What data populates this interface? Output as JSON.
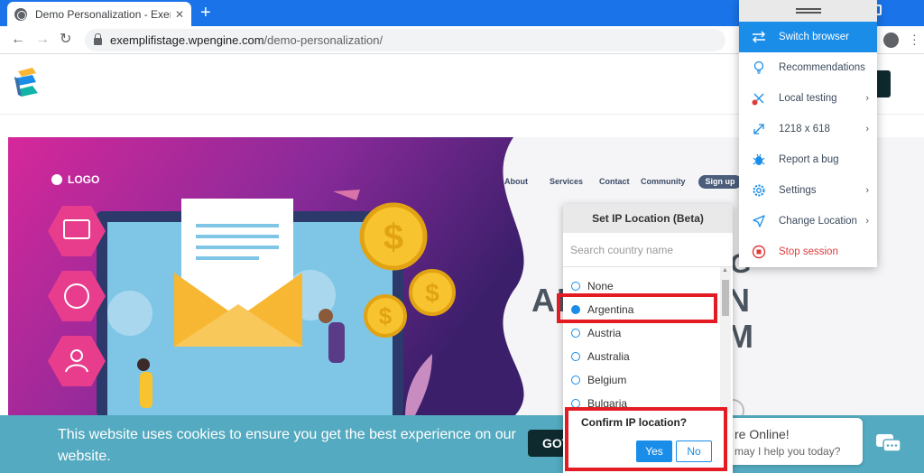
{
  "browser": {
    "tab_title": "Demo Personalization - Exemplifi",
    "tab_close": "✕",
    "new_tab": "+",
    "url_domain": "exemplifistage.wpengine.com",
    "url_path": "/demo-personalization/"
  },
  "hero": {
    "logo_text": "LOGO",
    "nav": {
      "about": "About",
      "services": "Services",
      "contact": "Contact",
      "community": "Community",
      "signup": "Sign up"
    },
    "headline_fragments": [
      "G",
      "AI",
      "N",
      "M"
    ]
  },
  "cookie": {
    "text": "This website uses cookies to ensure you get the best experience on our website.",
    "button": "GOT"
  },
  "chat": {
    "title": "re Online!",
    "subtitle": "may I help you today?"
  },
  "ip_panel": {
    "title": "Set IP Location (Beta)",
    "search_placeholder": "Search country name",
    "countries": [
      "None",
      "Argentina",
      "Austria",
      "Australia",
      "Belgium",
      "Bulgaria"
    ],
    "selected": "Argentina"
  },
  "confirm": {
    "title": "Confirm IP location?",
    "yes": "Yes",
    "no": "No"
  },
  "ext_menu": {
    "items": [
      {
        "label": "Switch browser",
        "icon": "switch-icon"
      },
      {
        "label": "Recommendations",
        "icon": "bulb-icon"
      },
      {
        "label": "Local testing",
        "icon": "local-testing-icon"
      },
      {
        "label": "1218 x 618",
        "icon": "resize-icon"
      },
      {
        "label": "Report a bug",
        "icon": "bug-icon"
      },
      {
        "label": "Settings",
        "icon": "gear-icon"
      },
      {
        "label": "Change Location",
        "icon": "location-icon"
      },
      {
        "label": "Stop session",
        "icon": "stop-icon"
      }
    ]
  },
  "colors": {
    "chrome_blue": "#1a73e8",
    "accent_blue": "#1a8de9",
    "highlight_red": "#e31b23",
    "cookie_teal": "#54aac0",
    "stop_red": "#e13a3a"
  }
}
